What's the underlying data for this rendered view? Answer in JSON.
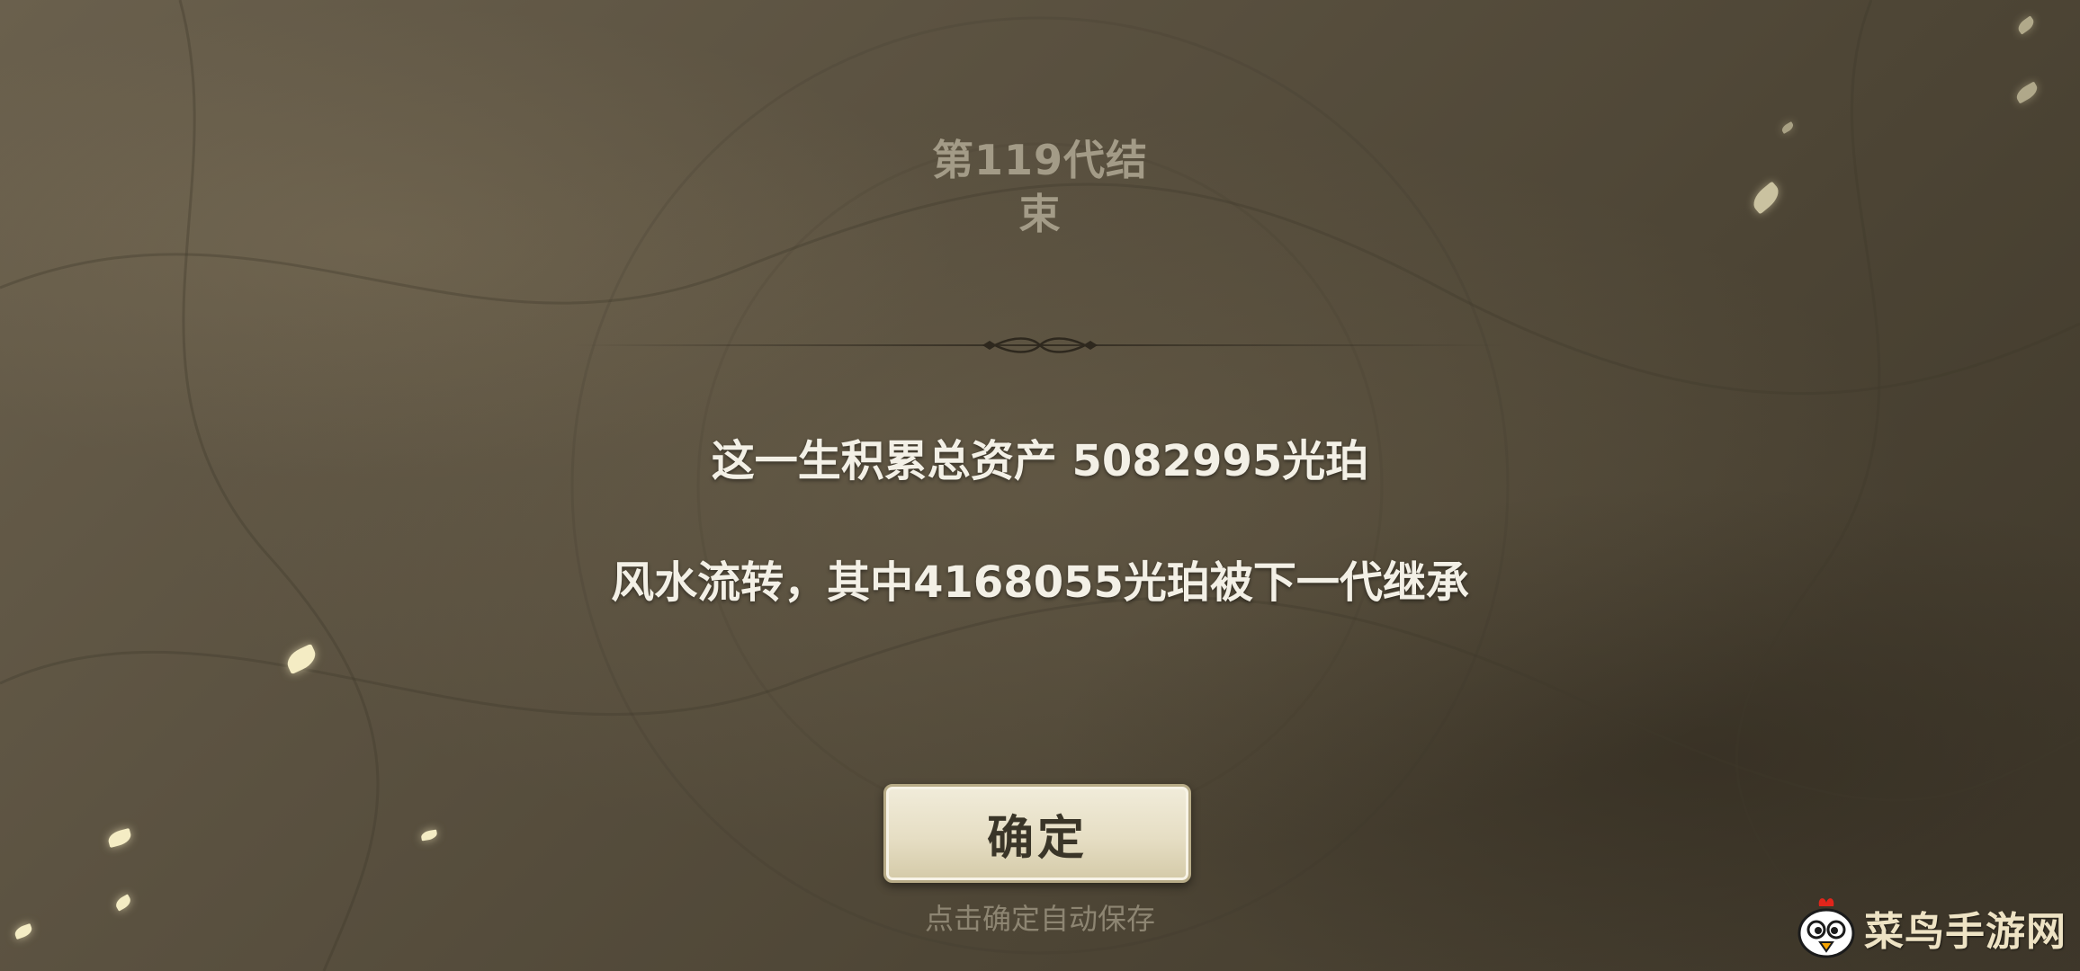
{
  "screen": {
    "title": "第119代结束",
    "title_line1": "第119代结",
    "title_line2": "束"
  },
  "summary": {
    "total_assets_line": "这一生积累总资产 5082995光珀",
    "inherited_line": "风水流转，其中4168055光珀被下一代继承"
  },
  "actions": {
    "confirm_label": "确定",
    "autosave_hint": "点击确定自动保存"
  },
  "watermark": {
    "text": "菜鸟手游网",
    "logo_icon": "rooster-mascot-icon"
  },
  "colors": {
    "background": "#5a5140",
    "title_text": "#a39b87",
    "summary_text": "#f3f0e6",
    "button_face": "#e6dec4",
    "button_text": "#3a3528",
    "hint_text": "#8d8572",
    "petal": "#f4ecc4",
    "watermark_text": "#eee3c4"
  }
}
